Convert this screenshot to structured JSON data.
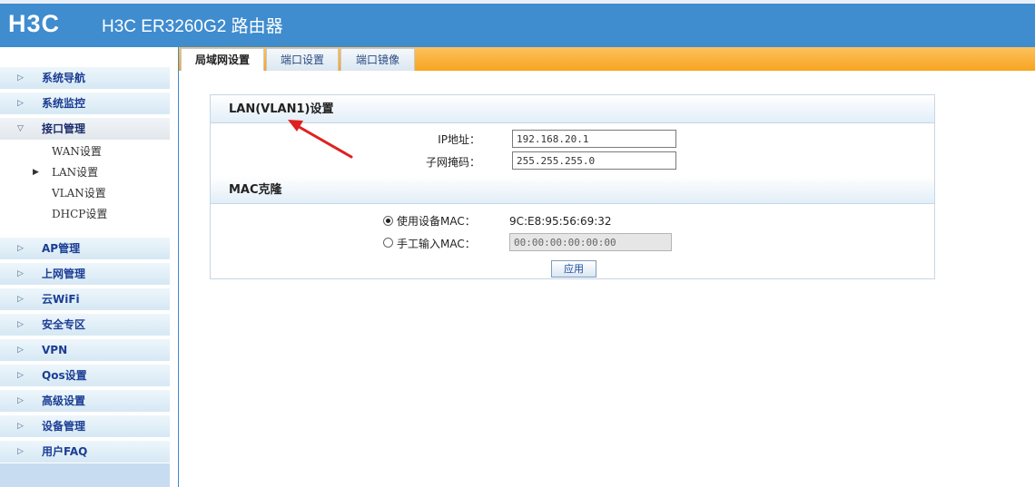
{
  "header": {
    "logo": "H3C",
    "title": "H3C ER3260G2 路由器"
  },
  "sidebar": {
    "items": [
      {
        "label": "系统导航",
        "expanded": false
      },
      {
        "label": "系统监控",
        "expanded": false
      },
      {
        "label": "接口管理",
        "expanded": true
      },
      {
        "label": "AP管理",
        "expanded": false
      },
      {
        "label": "上网管理",
        "expanded": false
      },
      {
        "label": "云WiFi",
        "expanded": false
      },
      {
        "label": "安全专区",
        "expanded": false
      },
      {
        "label": "VPN",
        "expanded": false
      },
      {
        "label": "Qos设置",
        "expanded": false
      },
      {
        "label": "高级设置",
        "expanded": false
      },
      {
        "label": "设备管理",
        "expanded": false
      },
      {
        "label": "用户FAQ",
        "expanded": false
      }
    ],
    "subitems": [
      {
        "label": "WAN设置",
        "current": false
      },
      {
        "label": "LAN设置",
        "current": true
      },
      {
        "label": "VLAN设置",
        "current": false
      },
      {
        "label": "DHCP设置",
        "current": false
      }
    ]
  },
  "tabs": [
    {
      "label": "局域网设置",
      "active": true
    },
    {
      "label": "端口设置",
      "active": false
    },
    {
      "label": "端口镜像",
      "active": false
    }
  ],
  "lan": {
    "title": "LAN(VLAN1)设置",
    "ip_label": "IP地址：",
    "ip_value": "192.168.20.1",
    "mask_label": "子网掩码：",
    "mask_value": "255.255.255.0"
  },
  "mac_clone": {
    "title": "MAC克隆",
    "use_device_label": "使用设备MAC：",
    "device_mac": "9C:E8:95:56:69:32",
    "manual_label": "手工输入MAC：",
    "manual_value": "00:00:00:00:00:00",
    "selected": "use_device"
  },
  "apply_label": "应用",
  "colors": {
    "header": "#3f8ccf",
    "tabbar": "#f7a520",
    "annotation_arrow": "#e02020"
  }
}
